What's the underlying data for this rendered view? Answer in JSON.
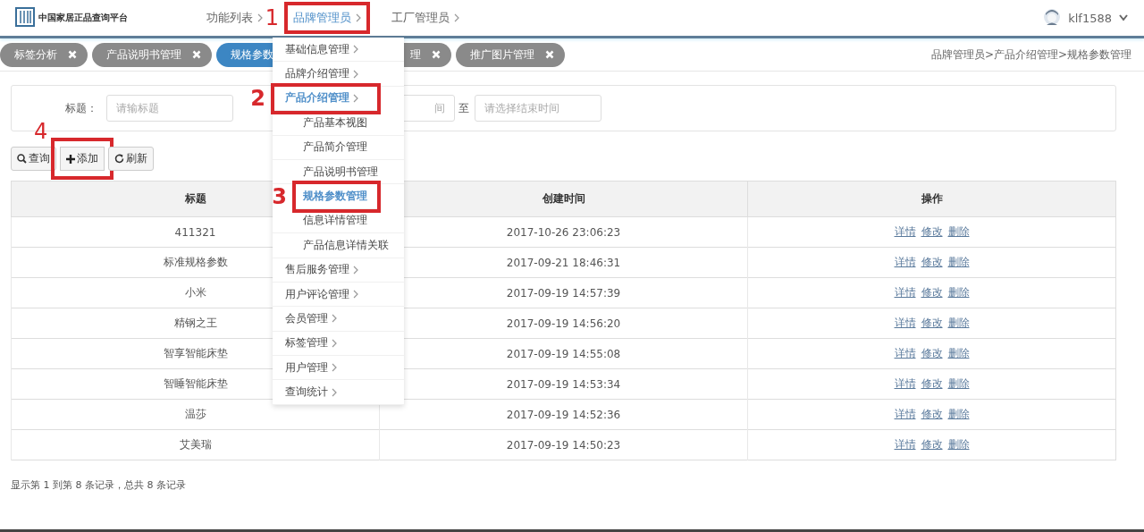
{
  "header": {
    "logo_text": "中国家居正品查询平台",
    "nav": [
      {
        "label": "功能列表",
        "selected": false,
        "highlighted": false
      },
      {
        "label": "品牌管理员",
        "selected": true,
        "highlighted": true,
        "step": "1"
      },
      {
        "label": "工厂管理员",
        "selected": false,
        "highlighted": false
      }
    ],
    "user": {
      "name": "klf1588"
    }
  },
  "tabs": [
    {
      "label": "标签分析",
      "selected": false
    },
    {
      "label": "产品说明书管理",
      "selected": false
    },
    {
      "label": "规格参数",
      "selected": true
    },
    {
      "label": "理",
      "selected": false
    },
    {
      "label": "推广图片管理",
      "selected": false
    }
  ],
  "breadcrumb": "品牌管理员>产品介绍管理>规格参数管理",
  "filters": {
    "title_label": "标题：",
    "title_placeholder": "请输标题",
    "start_placeholder": "间",
    "to_label": "至",
    "end_placeholder": "请选择结束时间"
  },
  "toolbar": [
    {
      "label": "查询",
      "highlighted": false
    },
    {
      "label": "添加",
      "highlighted": true,
      "step": "4"
    },
    {
      "label": "刷新",
      "highlighted": false
    }
  ],
  "table": {
    "columns": [
      "标题",
      "创建时间",
      "操作"
    ],
    "rows": [
      {
        "title": "411321",
        "created": "2017-10-26 23:06:23",
        "actions": [
          "详情",
          "修改",
          "删除"
        ]
      },
      {
        "title": "标准规格参数",
        "created": "2017-09-21 18:46:31",
        "actions": [
          "详情",
          "修改",
          "删除"
        ]
      },
      {
        "title": "小米",
        "created": "2017-09-19 14:57:39",
        "actions": [
          "详情",
          "修改",
          "删除"
        ]
      },
      {
        "title": "精钢之王",
        "created": "2017-09-19 14:56:20",
        "actions": [
          "详情",
          "修改",
          "删除"
        ]
      },
      {
        "title": "智享智能床垫",
        "created": "2017-09-19 14:55:08",
        "actions": [
          "详情",
          "修改",
          "删除"
        ]
      },
      {
        "title": "智睡智能床垫",
        "created": "2017-09-19 14:53:34",
        "actions": [
          "详情",
          "修改",
          "删除"
        ]
      },
      {
        "title": "温莎",
        "created": "2017-09-19 14:52:36",
        "actions": [
          "详情",
          "修改",
          "删除"
        ]
      },
      {
        "title": "艾美瑞",
        "created": "2017-09-19 14:50:23",
        "actions": [
          "详情",
          "修改",
          "删除"
        ]
      }
    ]
  },
  "footer": "显示第 1 到第 8 条记录，总共 8 条记录",
  "menu": {
    "items": [
      {
        "label": "基础信息管理",
        "selected": false,
        "highlighted": false
      },
      {
        "label": "品牌介绍管理",
        "selected": false,
        "highlighted": false
      },
      {
        "label": "产品介绍管理",
        "selected": true,
        "highlighted": true,
        "step": "2",
        "children": [
          {
            "label": "产品基本视图",
            "selected": false,
            "highlighted": false
          },
          {
            "label": "产品简介管理",
            "selected": false,
            "highlighted": false
          },
          {
            "label": "产品说明书管理",
            "selected": false,
            "highlighted": false
          },
          {
            "label": "规格参数管理",
            "selected": true,
            "highlighted": true,
            "step": "3"
          },
          {
            "label": "信息详情管理",
            "selected": false,
            "highlighted": false
          },
          {
            "label": "产品信息详情关联",
            "selected": false,
            "highlighted": false
          }
        ]
      },
      {
        "label": "售后服务管理",
        "selected": false,
        "highlighted": false
      },
      {
        "label": "用户评论管理",
        "selected": false,
        "highlighted": false
      },
      {
        "label": "会员管理",
        "selected": false,
        "highlighted": false
      },
      {
        "label": "标签管理",
        "selected": false,
        "highlighted": false
      },
      {
        "label": "用户管理",
        "selected": false,
        "highlighted": false
      },
      {
        "label": "查询统计",
        "selected": false,
        "highlighted": false
      }
    ]
  }
}
